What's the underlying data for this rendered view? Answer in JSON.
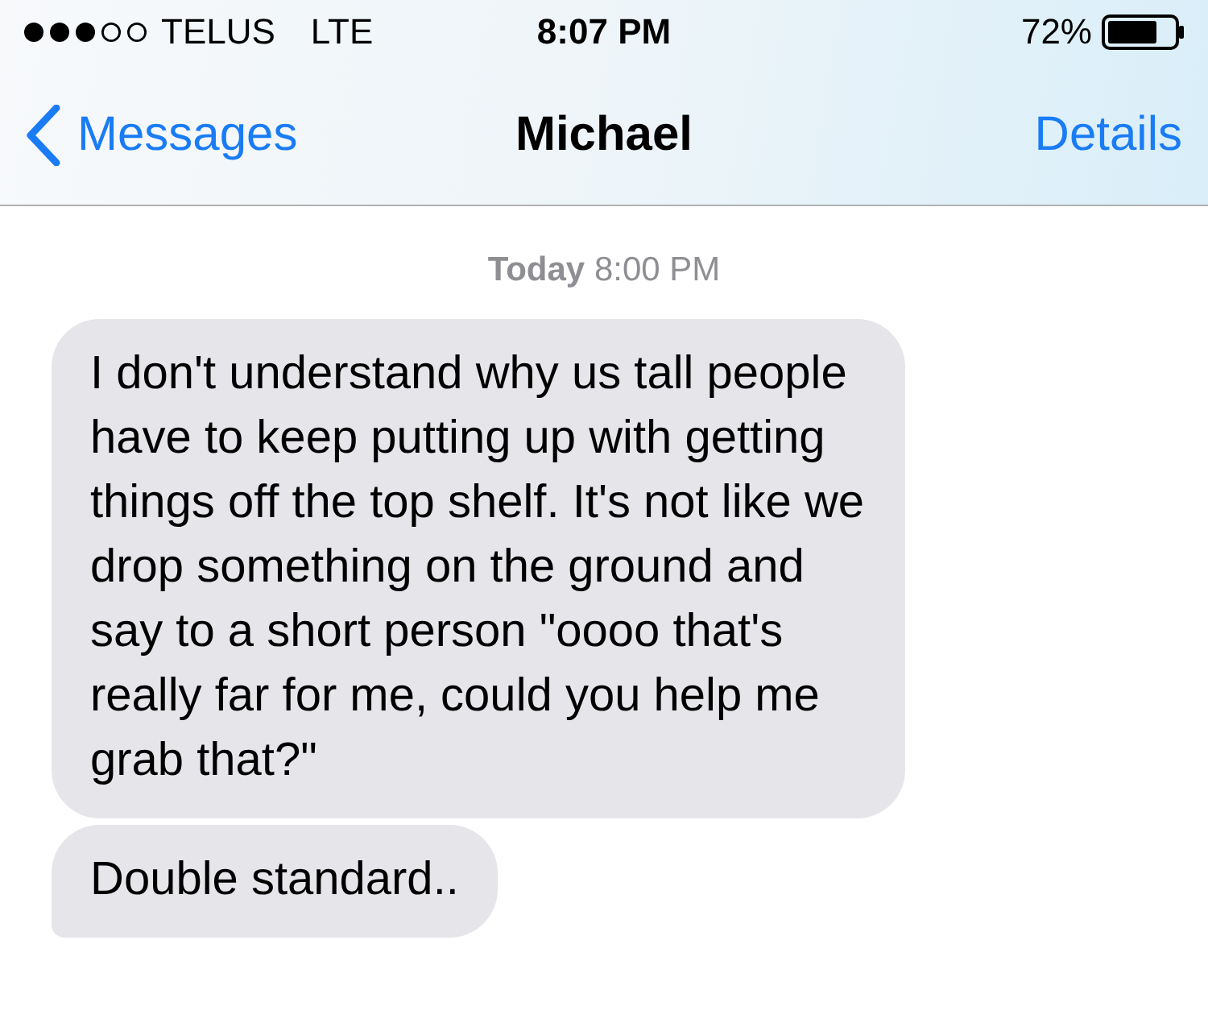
{
  "status_bar": {
    "carrier": "TELUS",
    "network": "LTE",
    "time": "8:07 PM",
    "battery": "72%"
  },
  "nav": {
    "back": "Messages",
    "title": "Michael",
    "action": "Details"
  },
  "timestamp": {
    "day": "Today",
    "time": "8:00 PM"
  },
  "messages": [
    {
      "text": "I don't understand why us tall people have to keep putting up with getting things off the top shelf. It's not like we drop something on the ground and say to a short person \"oooo that's really far for me, could you help me grab that?\"",
      "tail": false
    },
    {
      "text": "Double standard..",
      "tail": true
    }
  ]
}
